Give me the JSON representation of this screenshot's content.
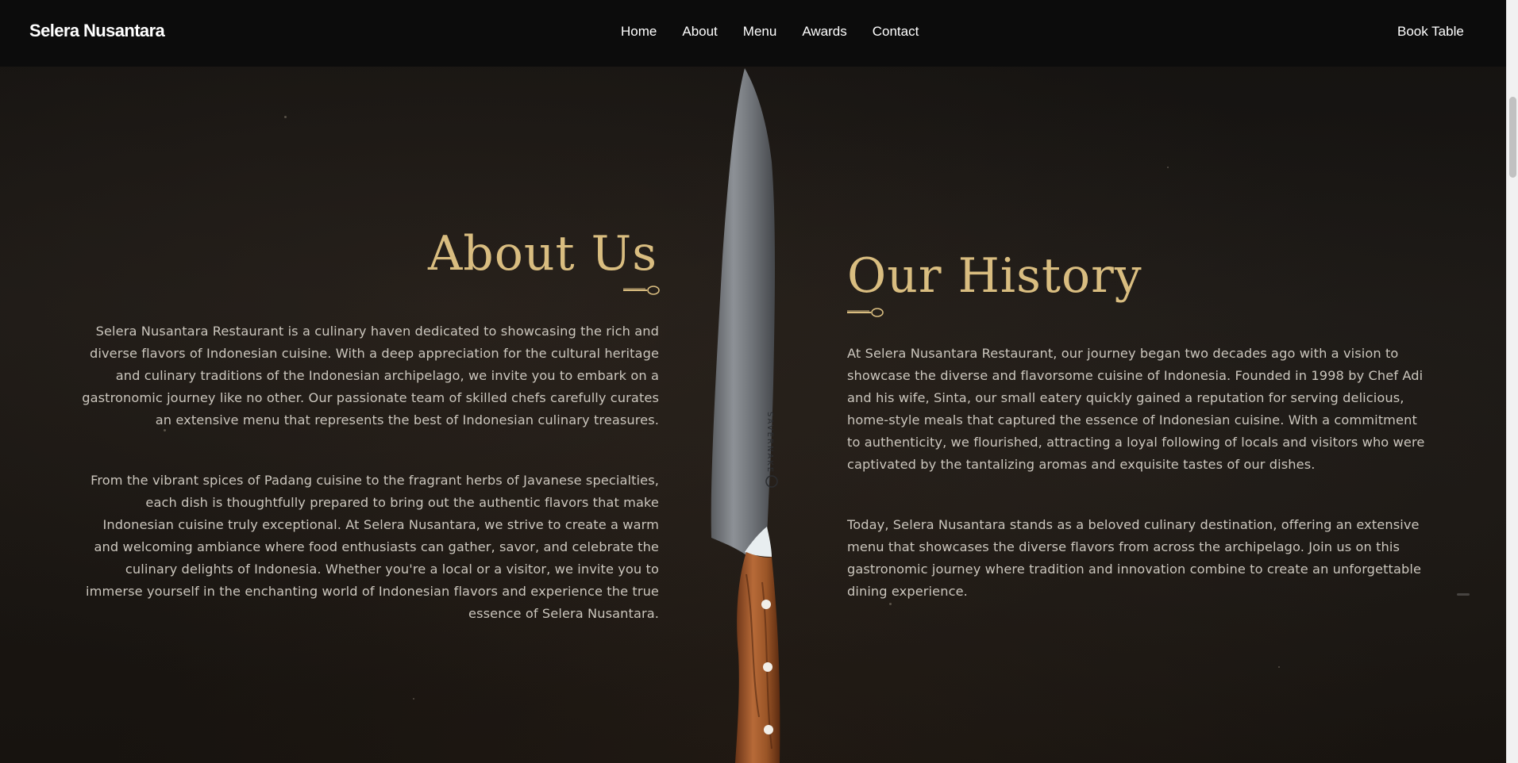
{
  "navbar": {
    "brand": "Selera Nusantara",
    "links": [
      {
        "label": "Home"
      },
      {
        "label": "About"
      },
      {
        "label": "Menu"
      },
      {
        "label": "Awards"
      },
      {
        "label": "Contact"
      }
    ],
    "cta_label": "Book Table"
  },
  "about": {
    "title": "About Us",
    "paragraphs": [
      "Selera Nusantara Restaurant is a culinary haven dedicated to showcasing the rich and diverse flavors of Indonesian cuisine. With a deep appreciation for the cultural heritage and culinary traditions of the Indonesian archipelago, we invite you to embark on a gastronomic journey like no other. Our passionate team of skilled chefs carefully curates an extensive menu that represents the best of Indonesian culinary treasures.",
      "From the vibrant spices of Padang cuisine to the fragrant herbs of Javanese specialties, each dish is thoughtfully prepared to bring out the authentic flavors that make Indonesian cuisine truly exceptional. At Selera Nusantara, we strive to create a warm and welcoming ambiance where food enthusiasts can gather, savor, and celebrate the culinary delights of Indonesia. Whether you're a local or a visitor, we invite you to immerse yourself in the enchanting world of Indonesian flavors and experience the true essence of Selera Nusantara."
    ]
  },
  "history": {
    "title": "Our History",
    "paragraphs": [
      "At Selera Nusantara Restaurant, our journey began two decades ago with a vision to showcase the diverse and flavorsome cuisine of Indonesia. Founded in 1998 by Chef Adi and his wife, Sinta, our small eatery quickly gained a reputation for serving delicious, home-style meals that captured the essence of Indonesian cuisine. With a commitment to authenticity, we flourished, attracting a loyal following of locals and visitors who were captivated by the tantalizing aromas and exquisite tastes of our dishes.",
      "Today, Selera Nusantara stands as a beloved culinary destination, offering an extensive menu that showcases the diverse flavors from across the archipelago. Join us on this gastronomic journey where tradition and innovation combine to create an unforgettable dining experience."
    ]
  },
  "knife": {
    "brand_engraving": "SAVERNAKE"
  },
  "colors": {
    "accent_gold": "#d9bd80",
    "navbar_bg": "#0c0c0c",
    "body_text": "#cbc6bd"
  },
  "icons": {
    "spoon": "spoon-divider-icon",
    "knife": "chef-knife-image"
  }
}
